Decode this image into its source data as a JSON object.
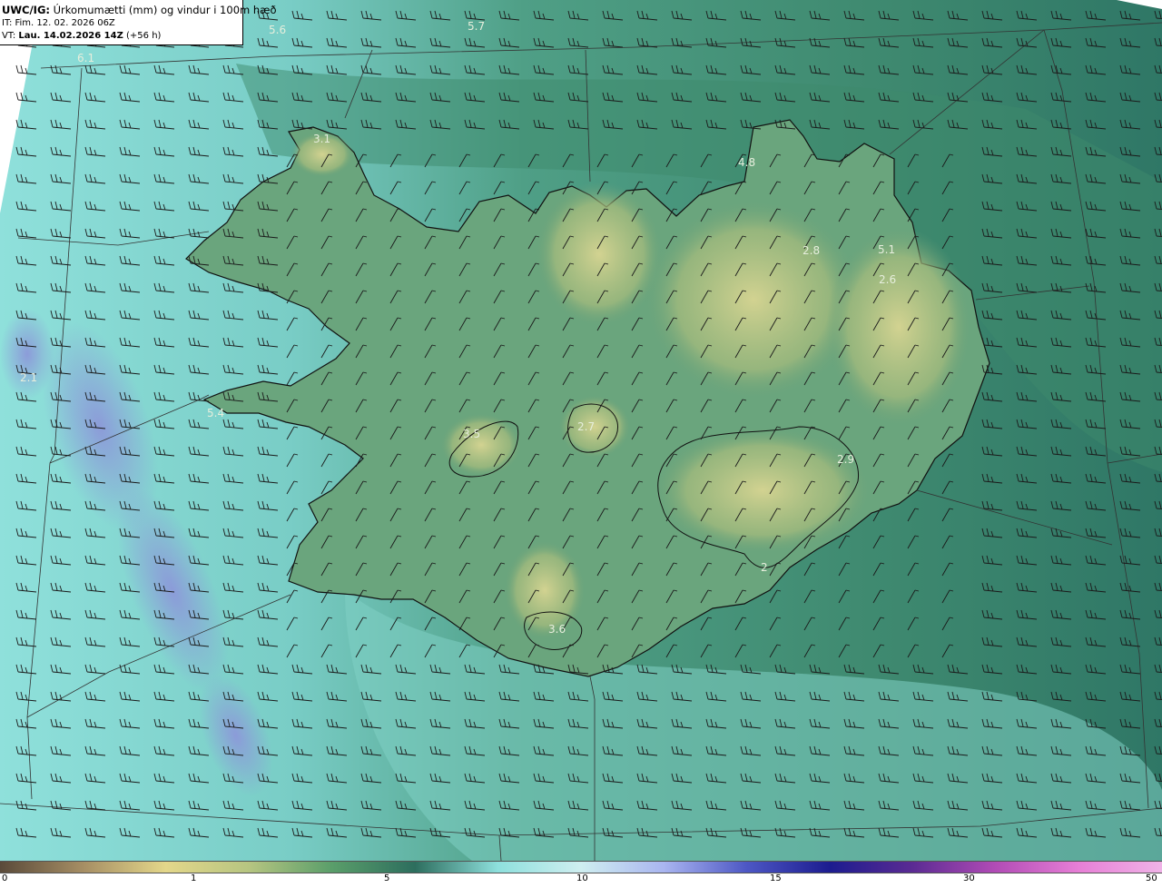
{
  "header": {
    "model": "UWC/IG:",
    "title": " Úrkomumætti (mm) og vindur i 100m hæð",
    "init_time": "IT: Fim. 12. 02. 2026 06Z",
    "valid_prefix": "VT: ",
    "valid_time": "Lau. 14.02.2026 14Z",
    "lead": " (+56 h)"
  },
  "colors": {
    "sea_mid": "#3f8a70",
    "sea_light": "#8ad7cf",
    "land_high": "#c2c98a",
    "max_blue": "#8c98d9",
    "coast_line": "#111111",
    "grid_line": "#333333"
  },
  "map_labels": [
    "5.6",
    "5.7",
    "6.1",
    "3.1",
    "4.8",
    "2.8",
    "5.1",
    "2.6",
    "2.1",
    "3.5",
    "2.7",
    "5.4",
    "3.6",
    "2.9",
    "2"
  ],
  "colorbar": {
    "stops": [
      "#5a4a3a",
      "#a68e64",
      "#e4d78a",
      "#b6c581",
      "#5a9e6a",
      "#2d6e5e",
      "#8ee0dd",
      "#cfeef0",
      "#a9b5f0",
      "#4d57c4",
      "#1c1c8f",
      "#5b2b93",
      "#b24cb6",
      "#e77fd6",
      "#f0b3e7"
    ],
    "ticks": [
      "0",
      "1",
      "5",
      "10",
      "15",
      "30",
      "50"
    ]
  }
}
